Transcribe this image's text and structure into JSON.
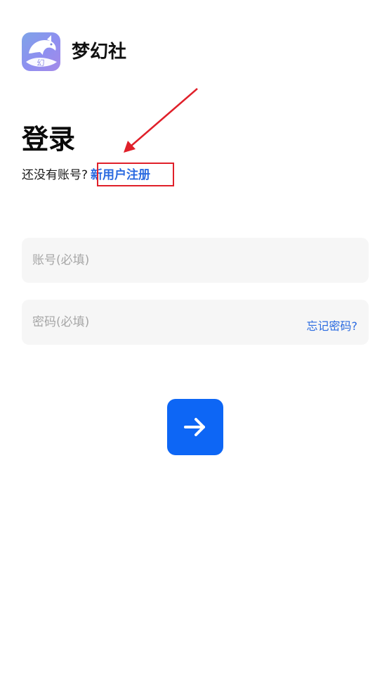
{
  "app": {
    "name": "梦幻社",
    "logo_icon": "dolphin-logo-icon",
    "logo_char": "幻"
  },
  "login": {
    "title": "登录",
    "no_account_text": "还没有账号?",
    "register_link": "新用户注册",
    "account_placeholder": "账号(必填)",
    "account_value": "",
    "password_placeholder": "密码(必填)",
    "password_value": "",
    "forgot_password": "忘记密码?",
    "submit_icon": "arrow-right-icon"
  },
  "annotation": {
    "highlight_color": "#e0202a",
    "arrow_color": "#e0202a"
  },
  "colors": {
    "accent": "#0d66f5",
    "link": "#2a6ae0",
    "field_bg": "#f6f6f6"
  }
}
